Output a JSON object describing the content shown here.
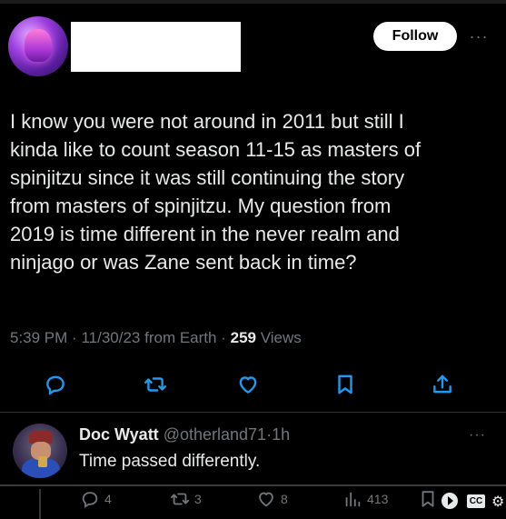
{
  "tweet": {
    "follow_label": "Follow",
    "more_label": "···",
    "text": "I know you were not around in 2011 but still I\nkinda like to count season 11-15 as masters of\nspinjitzu since it was still continuing the story\nfrom masters of spinjitzu. My question from\n2019 is time different in the never realm and\nninjago or was Zane sent back in time?",
    "time": "5:39 PM",
    "date": "11/30/23",
    "source": "from Earth",
    "views_count": "259",
    "views_label": "Views",
    "sep": "·"
  },
  "reply": {
    "name": "Doc Wyatt",
    "handle": "@otherland71",
    "time": "1h",
    "sep": "·",
    "text": "Time passed differently.",
    "more_label": "···",
    "reply_count": "4",
    "retweet_count": "3",
    "like_count": "8",
    "view_count": "413",
    "cc_label": "CC"
  },
  "icons": {
    "reply": "reply-icon",
    "retweet": "retweet-icon",
    "like": "heart-icon",
    "bookmark": "bookmark-icon",
    "share": "share-icon",
    "views": "views-chart-icon"
  },
  "colors": {
    "background": "#000000",
    "text_primary": "#e7e9ea",
    "text_secondary": "#71767b",
    "follow_bg": "#ffffff",
    "divider": "#2f3336"
  }
}
